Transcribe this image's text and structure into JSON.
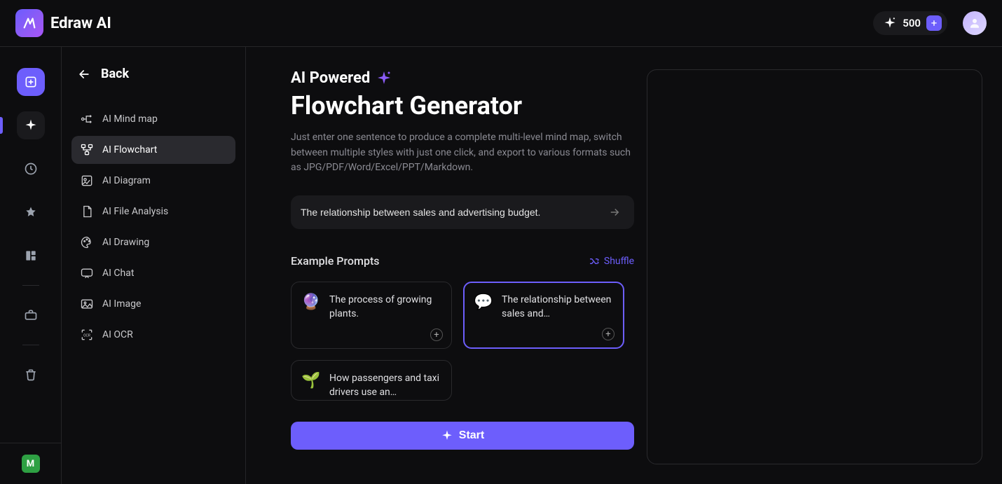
{
  "brand": "Edraw AI",
  "credits": {
    "count": "500"
  },
  "back_label": "Back",
  "sidebar": {
    "items": [
      {
        "label": "AI Mind map"
      },
      {
        "label": "AI Flowchart"
      },
      {
        "label": "AI Diagram"
      },
      {
        "label": "AI File Analysis"
      },
      {
        "label": "AI Drawing"
      },
      {
        "label": "AI Chat"
      },
      {
        "label": "AI Image"
      },
      {
        "label": "AI OCR"
      }
    ]
  },
  "page": {
    "overline": "AI Powered",
    "title": "Flowchart Generator",
    "description": "Just enter one sentence to produce a complete multi-level mind map, switch between multiple styles with just one click, and export to various formats such as JPG/PDF/Word/Excel/PPT/Markdown.",
    "prompt_value": "The relationship between sales and advertising budget.",
    "example_title": "Example Prompts",
    "shuffle_label": "Shuffle",
    "examples": [
      {
        "emoji": "🔮",
        "text": "The process of growing plants."
      },
      {
        "emoji": "💬",
        "text": "The relationship between sales and…"
      },
      {
        "emoji": "🌱",
        "text": "How passengers and taxi drivers use an…"
      }
    ],
    "start_label": "Start"
  },
  "footer_badge": "M"
}
